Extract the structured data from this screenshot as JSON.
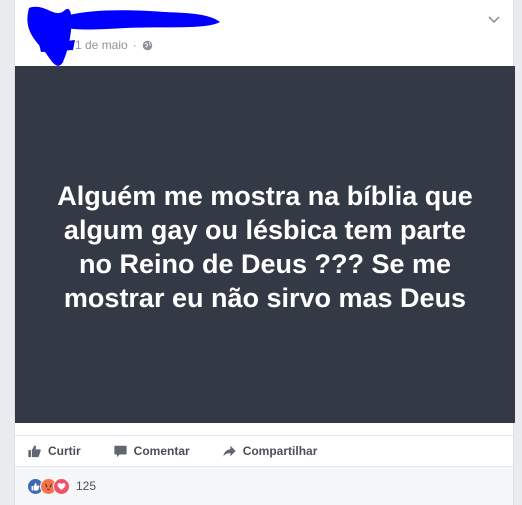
{
  "post": {
    "date": "1 de maio",
    "image_text": "Alguém me mostra na bíblia que algum gay ou lésbica tem parte no Reino de Deus ??? Se me mostrar eu não sirvo mas Deus"
  },
  "actions": {
    "like_label": "Curtir",
    "comment_label": "Comentar",
    "share_label": "Compartilhar"
  },
  "reactions": {
    "count": "125",
    "icons": [
      "like-icon",
      "angry-icon",
      "love-icon"
    ]
  },
  "colors": {
    "image_background": "#333a45",
    "redaction": "#0000ff",
    "like_blue": "#4267b2",
    "love_red": "#f25268",
    "angry_orange": "#f7714b"
  }
}
